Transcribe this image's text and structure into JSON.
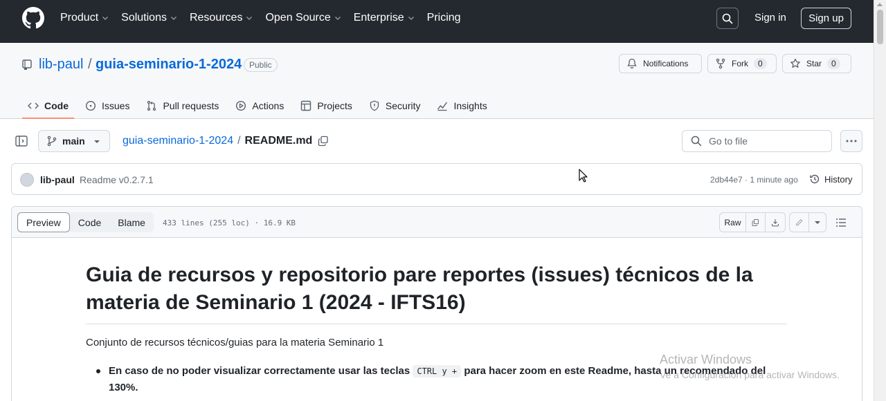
{
  "header": {
    "nav": [
      "Product",
      "Solutions",
      "Resources",
      "Open Source",
      "Enterprise",
      "Pricing"
    ],
    "nav_has_chevron": [
      true,
      true,
      true,
      true,
      true,
      false
    ],
    "sign_in": "Sign in",
    "sign_up": "Sign up"
  },
  "repo": {
    "owner": "lib-paul",
    "sep": "/",
    "name": "guia-seminario-1-2024",
    "visibility": "Public",
    "notifications": "Notifications",
    "fork_label": "Fork",
    "fork_count": "0",
    "star_label": "Star",
    "star_count": "0"
  },
  "tabs": [
    "Code",
    "Issues",
    "Pull requests",
    "Actions",
    "Projects",
    "Security",
    "Insights"
  ],
  "filenav": {
    "branch": "main",
    "crumb_repo": "guia-seminario-1-2024",
    "crumb_sep": "/",
    "crumb_file": "README.md",
    "goto_placeholder": "Go to file"
  },
  "commit": {
    "author": "lib-paul",
    "message": "Readme v0.2.7.1",
    "meta": "2db44e7 · 1 minute ago",
    "history": "History"
  },
  "file": {
    "modes": [
      "Preview",
      "Code",
      "Blame"
    ],
    "info": "433 lines (255 loc) · 16.9 KB",
    "raw": "Raw"
  },
  "readme": {
    "title": "Guia de recursos y repositorio pare reportes (issues) técnicos de la materia de Seminario 1 (2024 - IFTS16)",
    "intro": "Conjunto de recursos técnicos/guias para la materia Seminario 1",
    "li_part1": "En caso de no poder visualizar correctamente usar las teclas ",
    "li_kbd": "CTRL y +",
    "li_part2": " para hacer zoom en este Readme, hasta un recomendado del 130%."
  },
  "watermark": {
    "line1": "Activar Windows",
    "line2": "Ve a Configuración para activar Windows."
  },
  "colors": {
    "header_bg": "#24292f",
    "link": "#0969da",
    "tab_underline": "#fd8c73"
  }
}
